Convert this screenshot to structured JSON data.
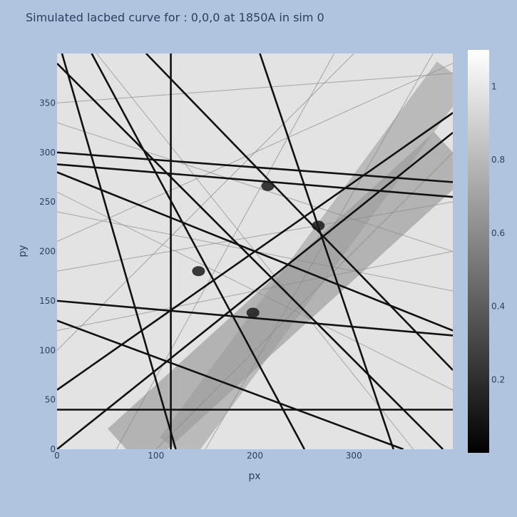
{
  "chart_data": {
    "type": "heatmap",
    "title": "Simulated lacbed curve for : 0,0,0 at 1850A in sim 0",
    "xlabel": "px",
    "ylabel": "py",
    "xlim": [
      0,
      400
    ],
    "ylim": [
      0,
      400
    ],
    "xticks": [
      0,
      100,
      200,
      300
    ],
    "yticks": [
      0,
      50,
      100,
      150,
      200,
      250,
      300,
      350
    ],
    "colorscale": "greys",
    "colorbar": {
      "range": [
        0,
        1.1
      ],
      "ticks": [
        0.2,
        0.4,
        0.6,
        0.8,
        1
      ]
    },
    "dark_lines": [
      {
        "x": [
          5,
          120
        ],
        "y": [
          400,
          0
        ]
      },
      {
        "x": [
          35,
          250
        ],
        "y": [
          400,
          0
        ]
      },
      {
        "x": [
          205,
          340
        ],
        "y": [
          400,
          0
        ]
      },
      {
        "x": [
          0,
          400
        ],
        "y": [
          300,
          270
        ]
      },
      {
        "x": [
          0,
          400
        ],
        "y": [
          288,
          255
        ]
      },
      {
        "x": [
          0,
          400
        ],
        "y": [
          150,
          115
        ]
      },
      {
        "x": [
          0,
          400
        ],
        "y": [
          280,
          120
        ]
      },
      {
        "x": [
          0,
          400
        ],
        "y": [
          60,
          340
        ]
      },
      {
        "x": [
          0,
          400
        ],
        "y": [
          0,
          320
        ]
      },
      {
        "x": [
          90,
          400
        ],
        "y": [
          400,
          80
        ]
      },
      {
        "x": [
          0,
          390
        ],
        "y": [
          390,
          0
        ]
      },
      {
        "x": [
          0,
          350
        ],
        "y": [
          130,
          0
        ]
      },
      {
        "x": [
          0,
          400
        ],
        "y": [
          40,
          40
        ]
      },
      {
        "x": [
          115,
          115
        ],
        "y": [
          400,
          0
        ]
      }
    ],
    "light_lines": [
      {
        "x": [
          0,
          400
        ],
        "y": [
          330,
          200
        ]
      },
      {
        "x": [
          0,
          400
        ],
        "y": [
          210,
          390
        ]
      },
      {
        "x": [
          0,
          300
        ],
        "y": [
          100,
          400
        ]
      },
      {
        "x": [
          100,
          400
        ],
        "y": [
          0,
          300
        ]
      },
      {
        "x": [
          0,
          400
        ],
        "y": [
          240,
          160
        ]
      },
      {
        "x": [
          0,
          400
        ],
        "y": [
          180,
          250
        ]
      },
      {
        "x": [
          60,
          280
        ],
        "y": [
          0,
          400
        ]
      },
      {
        "x": [
          150,
          380
        ],
        "y": [
          0,
          400
        ]
      },
      {
        "x": [
          0,
          400
        ],
        "y": [
          120,
          200
        ]
      },
      {
        "x": [
          40,
          360
        ],
        "y": [
          400,
          0
        ]
      },
      {
        "x": [
          0,
          400
        ],
        "y": [
          260,
          60
        ]
      },
      {
        "x": [
          0,
          400
        ],
        "y": [
          350,
          380
        ]
      }
    ],
    "dark_bands": [
      {
        "x": [
          70,
          400
        ],
        "y": [
          0,
          300
        ],
        "half_width": 28,
        "value": 0.55
      },
      {
        "x": [
          120,
          400
        ],
        "y": [
          0,
          380
        ],
        "half_width": 20,
        "value": 0.6
      }
    ],
    "spots": [
      {
        "x": 213,
        "y": 266
      },
      {
        "x": 264,
        "y": 226
      },
      {
        "x": 143,
        "y": 180
      },
      {
        "x": 198,
        "y": 138
      }
    ]
  }
}
